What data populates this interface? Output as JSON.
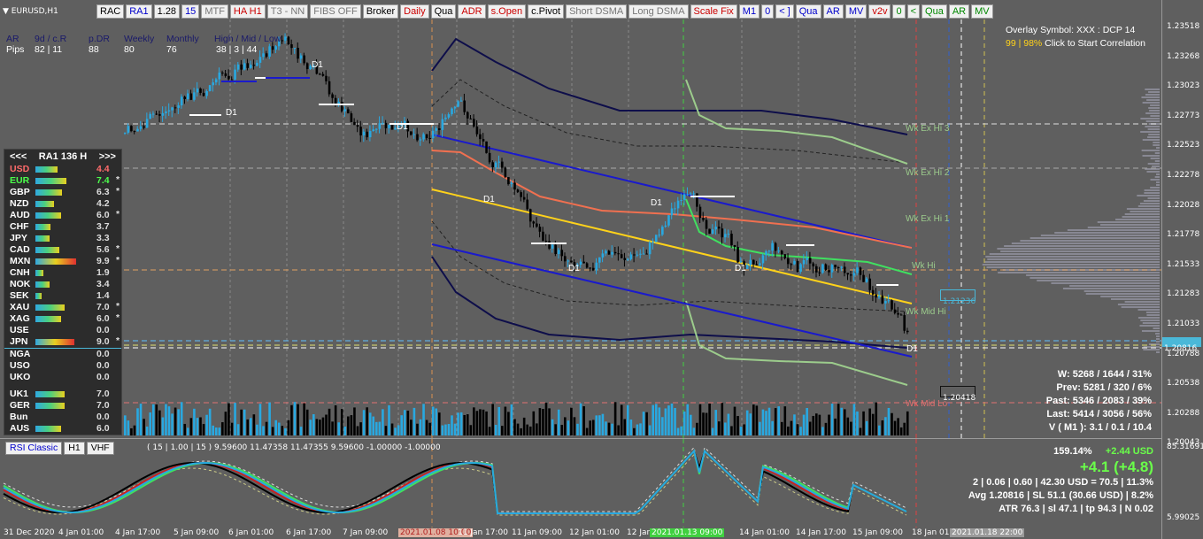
{
  "window": {
    "title": "EURUSD,H1"
  },
  "toolbar": [
    {
      "label": "RAC",
      "color": "#000000"
    },
    {
      "label": "RA1",
      "color": "#0000cc"
    },
    {
      "label": "1.28",
      "color": "#000000"
    },
    {
      "label": "15",
      "color": "#0000cc"
    },
    {
      "label": "MTF",
      "color": "#777777"
    },
    {
      "label": "HA H1",
      "color": "#cc0000"
    },
    {
      "label": "T3 - NN",
      "color": "#777777"
    },
    {
      "label": "FIBS OFF",
      "color": "#777777"
    },
    {
      "label": "Broker",
      "color": "#000000"
    },
    {
      "label": "Daily",
      "color": "#cc0000"
    },
    {
      "label": "Qua",
      "color": "#000000"
    },
    {
      "label": "ADR",
      "color": "#cc0000"
    },
    {
      "label": "s.Open",
      "color": "#cc0000"
    },
    {
      "label": "c.Pivot",
      "color": "#000000"
    },
    {
      "label": "Short DSMA",
      "color": "#777777"
    },
    {
      "label": "Long DSMA",
      "color": "#777777"
    },
    {
      "label": "Scale Fix",
      "color": "#cc0000"
    },
    {
      "label": "M1",
      "color": "#0000cc"
    },
    {
      "label": "0",
      "color": "#0000cc"
    },
    {
      "label": "< ]",
      "color": "#0000cc"
    },
    {
      "label": "Qua",
      "color": "#0000cc"
    },
    {
      "label": "AR",
      "color": "#0000cc"
    },
    {
      "label": "MV",
      "color": "#0000cc"
    },
    {
      "label": "v2v",
      "color": "#cc0000"
    },
    {
      "label": "0",
      "color": "#008800"
    },
    {
      "label": "<",
      "color": "#008800"
    },
    {
      "label": "Qua",
      "color": "#008800"
    },
    {
      "label": "AR",
      "color": "#008800"
    },
    {
      "label": "MV",
      "color": "#008800"
    }
  ],
  "header": {
    "labels": [
      "AR",
      "9d / c.R",
      "p.DR",
      "Weekly",
      "Monthly",
      "High / Mid / Low"
    ],
    "row_label": "Pips",
    "values": [
      "82 | 11",
      "88",
      "80",
      "76",
      "38 | 3 | 44"
    ]
  },
  "strength": {
    "left": "<<<",
    "title": "RA1  136  H",
    "right": ">>>",
    "rows": [
      {
        "cur": "USD",
        "val": "4.4",
        "star": "",
        "bar": 0.55,
        "curColor": "#ff6b6b",
        "valColor": "#ff6b6b"
      },
      {
        "cur": "EUR",
        "val": "7.4",
        "star": "*",
        "bar": 0.75,
        "curColor": "#4cff4c",
        "valColor": "#4cff4c"
      },
      {
        "cur": "GBP",
        "val": "6.3",
        "star": "*",
        "bar": 0.65,
        "curColor": "#ffffff",
        "valColor": "#dddddd"
      },
      {
        "cur": "NZD",
        "val": "4.2",
        "star": "",
        "bar": 0.45,
        "curColor": "#ffffff",
        "valColor": "#dddddd"
      },
      {
        "cur": "AUD",
        "val": "6.0",
        "star": "*",
        "bar": 0.63,
        "curColor": "#ffffff",
        "valColor": "#dddddd"
      },
      {
        "cur": "CHF",
        "val": "3.7",
        "star": "",
        "bar": 0.38,
        "curColor": "#ffffff",
        "valColor": "#dddddd"
      },
      {
        "cur": "JPY",
        "val": "3.3",
        "star": "",
        "bar": 0.34,
        "curColor": "#ffffff",
        "valColor": "#dddddd"
      },
      {
        "cur": "CAD",
        "val": "5.6",
        "star": "*",
        "bar": 0.58,
        "curColor": "#ffffff",
        "valColor": "#dddddd"
      },
      {
        "cur": "MXN",
        "val": "9.9",
        "star": "*",
        "bar": 1.0,
        "curColor": "#ffffff",
        "valColor": "#dddddd"
      },
      {
        "cur": "CNH",
        "val": "1.9",
        "star": "",
        "bar": 0.2,
        "curColor": "#ffffff",
        "valColor": "#dddddd"
      },
      {
        "cur": "NOK",
        "val": "3.4",
        "star": "",
        "bar": 0.35,
        "curColor": "#ffffff",
        "valColor": "#dddddd"
      },
      {
        "cur": "SEK",
        "val": "1.4",
        "star": "",
        "bar": 0.15,
        "curColor": "#ffffff",
        "valColor": "#dddddd"
      },
      {
        "cur": "XAU",
        "val": "7.0",
        "star": "*",
        "bar": 0.72,
        "curColor": "#ffffff",
        "valColor": "#dddddd"
      },
      {
        "cur": "XAG",
        "val": "6.0",
        "star": "*",
        "bar": 0.63,
        "curColor": "#ffffff",
        "valColor": "#dddddd"
      },
      {
        "cur": "USE",
        "val": "0.0",
        "star": "",
        "bar": 0,
        "curColor": "#ffffff",
        "valColor": "#dddddd"
      },
      {
        "cur": "JPN",
        "val": "9.0",
        "star": "*",
        "bar": 0.95,
        "curColor": "#ffffff",
        "valColor": "#dddddd"
      },
      {
        "cur": "NGA",
        "val": "0.0",
        "star": "",
        "bar": 0,
        "curColor": "#ffffff",
        "valColor": "#dddddd"
      },
      {
        "cur": "USO",
        "val": "0.0",
        "star": "",
        "bar": 0,
        "curColor": "#ffffff",
        "valColor": "#dddddd"
      },
      {
        "cur": "UKO",
        "val": "0.0",
        "star": "",
        "bar": 0,
        "curColor": "#ffffff",
        "valColor": "#dddddd"
      },
      {
        "cur": "",
        "val": "",
        "star": "",
        "bar": 0,
        "curColor": "#ffffff",
        "valColor": "#dddddd"
      },
      {
        "cur": "UK1",
        "val": "7.0",
        "star": "",
        "bar": 0.72,
        "curColor": "#ffffff",
        "valColor": "#dddddd"
      },
      {
        "cur": "GER",
        "val": "7.0",
        "star": "",
        "bar": 0.72,
        "curColor": "#ffffff",
        "valColor": "#dddddd"
      },
      {
        "cur": "Bun",
        "val": "0.0",
        "star": "",
        "bar": 0,
        "curColor": "#ffffff",
        "valColor": "#dddddd"
      },
      {
        "cur": "AUS",
        "val": "6.0",
        "star": "",
        "bar": 0.63,
        "curColor": "#ffffff",
        "valColor": "#dddddd"
      }
    ]
  },
  "price_axis": [
    "1.23518",
    "1.23268",
    "1.23023",
    "1.22773",
    "1.22523",
    "1.22278",
    "1.22028",
    "1.21778",
    "1.21533",
    "1.21283",
    "1.21033",
    "1.20788",
    "1.20538",
    "1.20288",
    "1.20043"
  ],
  "current_price": "1.20816",
  "price_boxes": [
    {
      "text": "1.21236",
      "color": "#4ab8d8"
    },
    {
      "text": "1.20418",
      "color": "#222222"
    }
  ],
  "time_axis": [
    "31 Dec 2020",
    "4 Jan 01:00",
    "4 Jan 17:00",
    "5 Jan 09:00",
    "6 Jan 01:00",
    "6 Jan 17:00",
    "7 Jan 09:00",
    "2021.01.08 10:00",
    "11 Jan 17:00",
    "11 Jan 09:00",
    "12 Jan 01:00",
    "12 Jan 17:00",
    "2021.01.13 09:00",
    "14 Jan 01:00",
    "14 Jan 17:00",
    "15 Jan 09:00",
    "18 Jan 01:00",
    "2021.01.18 22:00"
  ],
  "week_labels": [
    "Wk Ex Hi 3",
    "Wk Ex Hi 2",
    "Wk Ex Hi 1",
    "Wk Hi",
    "Wk Mid Hi",
    "Wk Mid Lo"
  ],
  "d1_labels": [
    "D1",
    "D1",
    "D1",
    "D1",
    "D1",
    "D1",
    "D1",
    "D1"
  ],
  "overlay": {
    "line1": "Overlay Symbol: XXX : DCP 14",
    "line2_a": "99 | 98%",
    "line2_b": " Click to Start Correlation"
  },
  "stats": [
    "W: 5268 / 1644 / 31%",
    "Prev: 5281 / 320 / 6%",
    "Past: 5346 / 2083 / 39%",
    "Last: 5414 / 3056 / 56%",
    "V ( M1 ): 3.1 / 0.1 / 10.4"
  ],
  "subwindow": {
    "tabs": [
      "RSI Classic",
      "H1",
      "VHF"
    ],
    "params": "( 15 | 1.00 | 15 ) 9.59600 11.47358 11.47355 9.59600 -1.00000 -1.00000",
    "axis_top": "85.31691",
    "axis_bottom": "5.99025"
  },
  "pnl": {
    "pct": "159.14%",
    "usd": "+2.44 USD",
    "big": "+4.1 (+4.8)",
    "line3": "2  |  0.06  |  0.60  |  42.30 USD = 70.5  |  11.3%",
    "line4": "Avg 1.20816  |  SL 51.1 (30.66 USD)  |  8.2%",
    "line5": "ATR 76.3  |  sl 47.1  |  tp 94.3  |  N 0.02"
  },
  "colors": {
    "background": "#5f5f5f",
    "bull_candle": "#29a8e0",
    "bear_candle": "#000000",
    "channel": "#1a1acc",
    "regression": "#ffd21a",
    "ma_red": "#f07050",
    "ma_green": "#40e060",
    "envelope_navy": "#0e0e4a",
    "envelope_light": "#9ccc8c"
  }
}
